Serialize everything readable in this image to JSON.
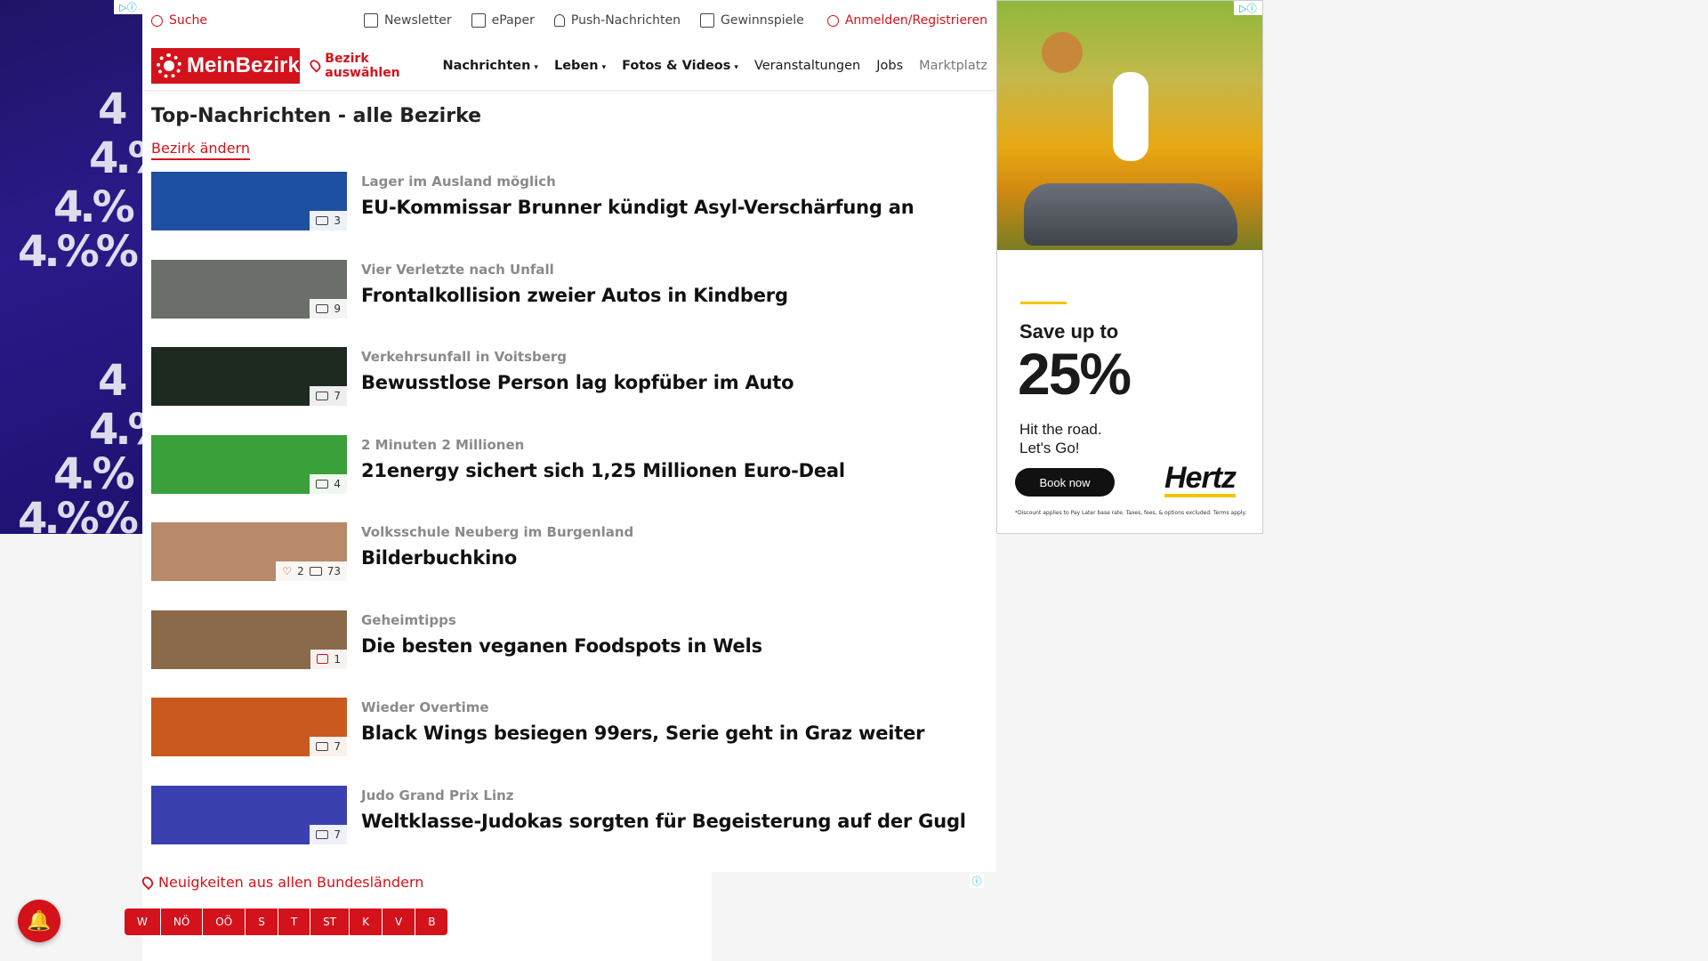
{
  "topbar": {
    "search": "Suche",
    "newsletter": "Newsletter",
    "epaper": "ePaper",
    "push": "Push-Nachrichten",
    "gewinnspiele": "Gewinnspiele",
    "login": "Anmelden/Registrieren"
  },
  "nav": {
    "logo": "MeinBezirk",
    "bezirk": "Bezirk auswählen",
    "items": [
      "Nachrichten",
      "Leben",
      "Fotos & Videos",
      "Veranstaltungen",
      "Jobs",
      "Marktplatz"
    ]
  },
  "section": {
    "title": "Top-Nachrichten - alle Bezirke",
    "change": "Bezirk ändern"
  },
  "articles": [
    {
      "kicker": "Lager im Ausland möglich",
      "headline": "EU-Kommissar Brunner kündigt Asyl-Verschärfung an",
      "images": "3",
      "likes": "",
      "comments": "",
      "thumb_color": "#1f4fa0"
    },
    {
      "kicker": "Vier Verletzte nach Unfall",
      "headline": "Frontalkollision zweier Autos in Kindberg",
      "images": "9",
      "likes": "",
      "comments": "",
      "thumb_color": "#6b6f6a"
    },
    {
      "kicker": "Verkehrsunfall in Voitsberg",
      "headline": "Bewusstlose Person lag kopfüber im Auto",
      "images": "7",
      "likes": "",
      "comments": "",
      "thumb_color": "#1e2a1f"
    },
    {
      "kicker": "2 Minuten 2 Millionen",
      "headline": "21energy sichert sich 1,25 Millionen Euro-Deal",
      "images": "4",
      "likes": "",
      "comments": "",
      "thumb_color": "#3aa03a"
    },
    {
      "kicker": "Volksschule Neuberg im Burgenland",
      "headline": "Bilderbuchkino",
      "images": "73",
      "likes": "2",
      "comments": "",
      "thumb_color": "#b88a6a"
    },
    {
      "kicker": "Geheimtipps",
      "headline": "Die besten veganen Foodspots in Wels",
      "images": "",
      "likes": "",
      "comments": "1",
      "thumb_color": "#8a6a4a"
    },
    {
      "kicker": "Wieder Overtime",
      "headline": "Black Wings besiegen 99ers, Serie geht in Graz weiter",
      "images": "7",
      "likes": "",
      "comments": "",
      "thumb_color": "#c85a20"
    },
    {
      "kicker": "Judo Grand Prix Linz",
      "headline": "Weltklasse-Judokas sorgten für Begeisterung auf der Gugl",
      "images": "7",
      "likes": "",
      "comments": "",
      "thumb_color": "#3a40b0"
    }
  ],
  "footer": {
    "news_all": "Neuigkeiten aus allen Bundesländern",
    "states": [
      "W",
      "NÖ",
      "OÖ",
      "S",
      "T",
      "ST",
      "K",
      "V",
      "B"
    ]
  },
  "ad": {
    "save": "Save up to",
    "percent": "25%",
    "sub1": "Hit the road.",
    "sub2": "Let's Go!",
    "book": "Book now",
    "brand": "Hertz",
    "fine": "*Discount applies to Pay Later base rate. Taxes, fees, & options excluded. Terms apply."
  },
  "colors": {
    "brand_red": "#d4121b",
    "ad_yellow": "#f5c400"
  }
}
